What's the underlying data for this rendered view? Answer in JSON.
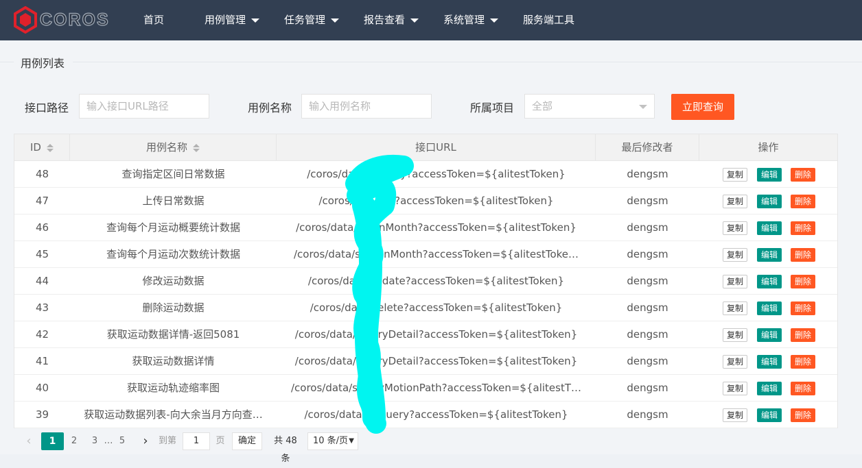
{
  "nav": {
    "logo_text": "COROS",
    "items": [
      {
        "label": "首页",
        "dropdown": false
      },
      {
        "label": "用例管理",
        "dropdown": true
      },
      {
        "label": "任务管理",
        "dropdown": true
      },
      {
        "label": "报告查看",
        "dropdown": true
      },
      {
        "label": "系统管理",
        "dropdown": true
      },
      {
        "label": "服务端工具",
        "dropdown": false
      }
    ]
  },
  "section_title": "用例列表",
  "filters": {
    "path_label": "接口路径",
    "path_placeholder": "输入接口URL路径",
    "name_label": "用例名称",
    "name_placeholder": "输入用例名称",
    "project_label": "所属项目",
    "project_value": "全部",
    "query_button": "立即查询"
  },
  "table": {
    "headers": [
      "ID",
      "用例名称",
      "接口URL",
      "最后修改者",
      "操作"
    ],
    "ops": {
      "copy": "复制",
      "edit": "编辑",
      "delete": "删除"
    },
    "rows": [
      {
        "id": "48",
        "name": "查询指定区间日常数据",
        "url": "/coros/data/s...uery?accessToken=${alitestToken}",
        "modifier": "dengsm"
      },
      {
        "id": "47",
        "name": "上传日常数据",
        "url": "/coros/da...ave?accessToken=${alitestToken}",
        "modifier": "dengsm"
      },
      {
        "id": "46",
        "name": "查询每个月运动概要统计数据",
        "url": "/coros/data/sp...nMonth?accessToken=${alitestToken}",
        "modifier": "dengsm"
      },
      {
        "id": "45",
        "name": "查询每个月运动次数统计数据",
        "url": "/coros/data/sp...tInMonth?accessToken=${alitestToke…",
        "modifier": "dengsm"
      },
      {
        "id": "44",
        "name": "修改运动数据",
        "url": "/coros/data...pdate?accessToken=${alitestToken}",
        "modifier": "dengsm"
      },
      {
        "id": "43",
        "name": "删除运动数据",
        "url": "/coros/data...elete?accessToken=${alitestToken}",
        "modifier": "dengsm"
      },
      {
        "id": "42",
        "name": "获取运动数据详情-返回5081",
        "url": "/coros/data/sp...ryDetail?accessToken=${alitestToken}",
        "modifier": "dengsm"
      },
      {
        "id": "41",
        "name": "获取运动数据详情",
        "url": "/coros/data/sp...ryDetail?accessToken=${alitestToken}",
        "modifier": "dengsm"
      },
      {
        "id": "40",
        "name": "获取运动轨迹缩率图",
        "url": "/coros/data/sp...ryMotionPath?accessToken=${alitestT…",
        "modifier": "dengsm"
      },
      {
        "id": "39",
        "name": "获取运动数据列表-向大余当月方向查…",
        "url": "/coros/data...t/query?accessToken=${alitestToken}",
        "modifier": "dengsm"
      }
    ]
  },
  "pagination": {
    "prev": "‹",
    "pages": [
      "1",
      "2",
      "3",
      "…",
      "5"
    ],
    "current": "1",
    "next": "›",
    "goto_label": "到第",
    "goto_value": "1",
    "page_unit": "页",
    "confirm": "确定",
    "total": "共 48 条",
    "page_size": "10 条/页"
  }
}
